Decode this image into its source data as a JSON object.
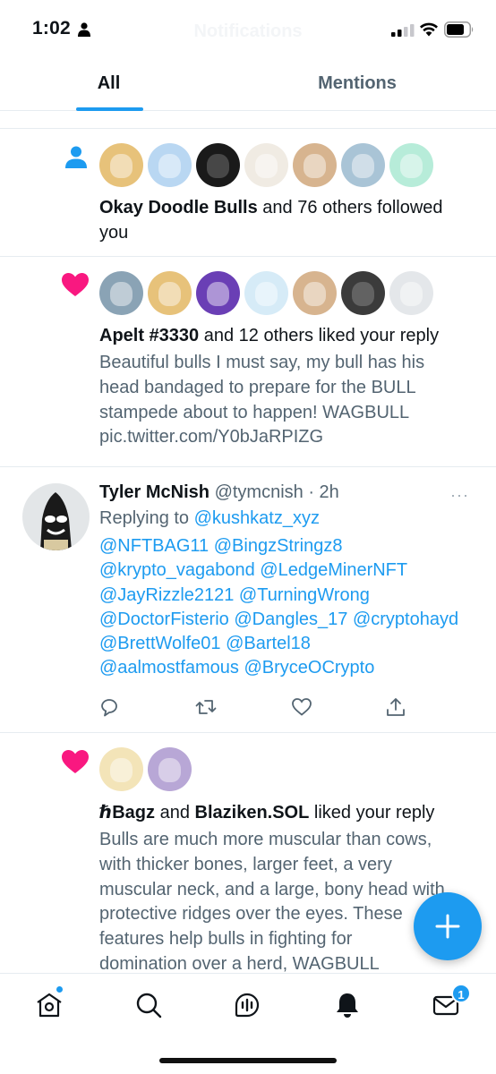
{
  "status_bar": {
    "time": "1:02",
    "ghost_title": "Notifications"
  },
  "tabs": [
    {
      "label": "All",
      "active": true
    },
    {
      "label": "Mentions",
      "active": false
    }
  ],
  "notifications": {
    "follow": {
      "icon": "person-icon",
      "actor": "Okay Doodle Bulls",
      "text_after_actor": " and 76 others followed",
      "text_line2": "you",
      "avatar_colors": [
        "#e7c27a",
        "#b9d7f2",
        "#1a1a1a",
        "#f0ebe3",
        "#d7b48f",
        "#a9c4d6",
        "#b7ecd9"
      ]
    },
    "like_1": {
      "icon": "heart-icon",
      "actor": "Apelt #3330",
      "text_after_actor": " and 12 others liked your reply",
      "body_lines": [
        "Beautiful bulls I must say, my bull has his",
        "head bandaged to prepare for the BULL",
        "stampede about to happen! WAGBULL",
        "pic.twitter.com/Y0bJaRPIZG"
      ],
      "avatar_colors": [
        "#8aa3b5",
        "#e7c27a",
        "#6a3fb5",
        "#d6ebf7",
        "#d7b48f",
        "#3b3b3b",
        "#e4e7ea"
      ]
    },
    "reply": {
      "name": "Tyler McNish",
      "handle": "@tymcnish",
      "time": " · 2h",
      "more": "···",
      "replying_label": "Replying to ",
      "replying_handle": "@kushkatz_xyz",
      "mention_lines": [
        "@NFTBAG11 @BingzStringz8",
        "@krypto_vagabond @LedgeMinerNFT",
        "@JayRizzle2121 @TurningWrong",
        "@DoctorFisterio @Dangles_17 @cryptohayd",
        "@BrettWolfe01 @Bartel18",
        "@aalmostfamous @BryceOCrypto"
      ]
    },
    "like_2": {
      "icon": "heart-icon",
      "actor_1": "ℏBagz",
      "joiner": " and ",
      "actor_2": "Blaziken.SOL",
      "text_after_actor": " liked your reply",
      "body_lines": [
        "Bulls are much more muscular than cows,",
        "with thicker bones, larger feet, a very",
        "muscular neck, and a large, bony head with",
        "protective ridges over the eyes. These",
        "features help bulls in fighting for",
        "domination over a herd, WAGBULL"
      ],
      "avatar_colors": [
        "#f3e4b8",
        "#b8a7d6"
      ]
    }
  },
  "bottom_nav": {
    "messages_badge": "1"
  },
  "colors": {
    "accent": "#1d9bf0",
    "like": "#f91880",
    "text": "#0f1419",
    "secondary_text": "#536471"
  }
}
